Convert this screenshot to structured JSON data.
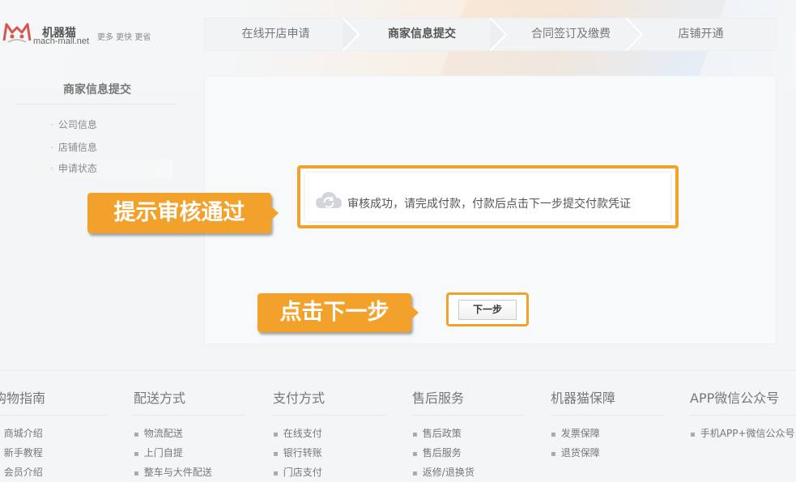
{
  "brand": {
    "name": "机器猫",
    "domain": "mach-mall.net",
    "slogan": "更多 更快 更省",
    "accent": "#f2a22b"
  },
  "steps": [
    {
      "label": "在线开店申请",
      "active": false
    },
    {
      "label": "商家信息提交",
      "active": true
    },
    {
      "label": "合同签订及缴费",
      "active": false
    },
    {
      "label": "店铺开通",
      "active": false
    }
  ],
  "sidebar": {
    "title": "商家信息提交",
    "items": [
      {
        "label": "公司信息"
      },
      {
        "label": "店铺信息"
      },
      {
        "label": "申请状态"
      }
    ]
  },
  "main": {
    "message": "审核成功，请完成付款，付款后点击下一步提交付款凭证",
    "next_label": "下一步"
  },
  "callouts": {
    "review_passed": "提示审核通过",
    "click_next": "点击下一步"
  },
  "footer": {
    "columns": [
      {
        "title": "购物指南",
        "items": [
          "商城介绍",
          "新手教程",
          "会员介绍"
        ]
      },
      {
        "title": "配送方式",
        "items": [
          "物流配送",
          "上门自提",
          "整车与大件配送"
        ]
      },
      {
        "title": "支付方式",
        "items": [
          "在线支付",
          "银行转账",
          "门店支付"
        ]
      },
      {
        "title": "售后服务",
        "items": [
          "售后政策",
          "售后服务",
          "返修/退换货"
        ]
      },
      {
        "title": "机器猫保障",
        "items": [
          "发票保障",
          "退货保障"
        ]
      },
      {
        "title": "APP微信公众号",
        "items": [
          "手机APP+微信公众号"
        ]
      }
    ]
  }
}
